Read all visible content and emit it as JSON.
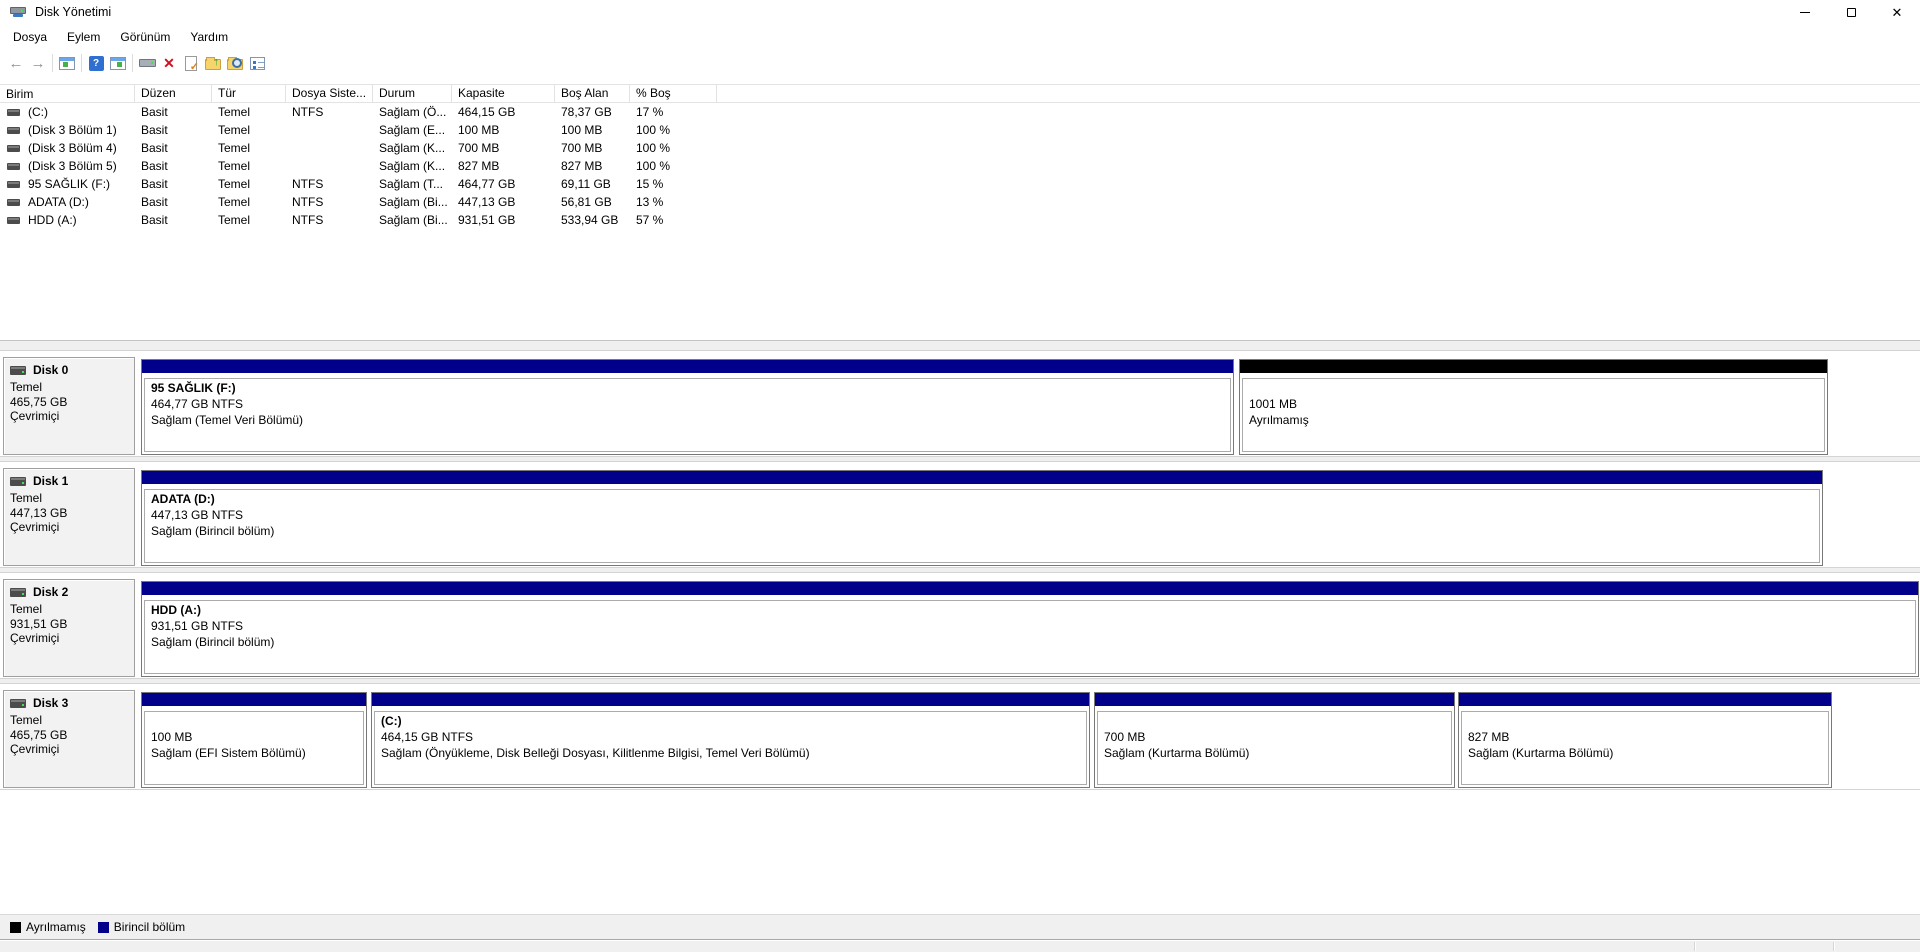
{
  "window": {
    "title": "Disk Yönetimi",
    "controls": [
      "minimize",
      "maximize",
      "close"
    ]
  },
  "menu": {
    "items": [
      "Dosya",
      "Eylem",
      "Görünüm",
      "Yardım"
    ]
  },
  "toolbar": {
    "icons": [
      "back",
      "forward",
      "show-console-tree",
      "help",
      "show-action-pane",
      "drive",
      "delete-volume",
      "check-document",
      "folder-add",
      "folder-search",
      "properties"
    ]
  },
  "volume_list": {
    "columns": [
      "Birim",
      "Düzen",
      "Tür",
      "Dosya Siste...",
      "Durum",
      "Kapasite",
      "Boş Alan",
      "% Boş"
    ],
    "rows": [
      {
        "name": "(C:)",
        "layout": "Basit",
        "type": "Temel",
        "fs": "NTFS",
        "status": "Sağlam (Ö...",
        "capacity": "464,15 GB",
        "free": "78,37 GB",
        "pct": "17 %"
      },
      {
        "name": "(Disk 3 Bölüm 1)",
        "layout": "Basit",
        "type": "Temel",
        "fs": "",
        "status": "Sağlam (E...",
        "capacity": "100 MB",
        "free": "100 MB",
        "pct": "100 %"
      },
      {
        "name": "(Disk 3 Bölüm 4)",
        "layout": "Basit",
        "type": "Temel",
        "fs": "",
        "status": "Sağlam (K...",
        "capacity": "700 MB",
        "free": "700 MB",
        "pct": "100 %"
      },
      {
        "name": "(Disk 3 Bölüm 5)",
        "layout": "Basit",
        "type": "Temel",
        "fs": "",
        "status": "Sağlam (K...",
        "capacity": "827 MB",
        "free": "827 MB",
        "pct": "100 %"
      },
      {
        "name": "95 SAĞLIK (F:)",
        "layout": "Basit",
        "type": "Temel",
        "fs": "NTFS",
        "status": "Sağlam (T...",
        "capacity": "464,77 GB",
        "free": "69,11 GB",
        "pct": "15 %"
      },
      {
        "name": "ADATA (D:)",
        "layout": "Basit",
        "type": "Temel",
        "fs": "NTFS",
        "status": "Sağlam (Bi...",
        "capacity": "447,13 GB",
        "free": "56,81 GB",
        "pct": "13 %"
      },
      {
        "name": "HDD (A:)",
        "layout": "Basit",
        "type": "Temel",
        "fs": "NTFS",
        "status": "Sağlam (Bi...",
        "capacity": "931,51 GB",
        "free": "533,94 GB",
        "pct": "57 %"
      }
    ]
  },
  "disks": [
    {
      "label": "Disk 0",
      "type": "Temel",
      "size": "465,75 GB",
      "status": "Çevrimiçi",
      "partitions": [
        {
          "title": "95 SAĞLIK  (F:)",
          "line2": "464,77 GB NTFS",
          "line3": "Sağlam (Temel Veri Bölümü)",
          "kind": "primary"
        },
        {
          "title": "",
          "line2": "1001 MB",
          "line3": "Ayrılmamış",
          "kind": "unallocated"
        }
      ]
    },
    {
      "label": "Disk 1",
      "type": "Temel",
      "size": "447,13 GB",
      "status": "Çevrimiçi",
      "partitions": [
        {
          "title": "ADATA  (D:)",
          "line2": "447,13 GB NTFS",
          "line3": "Sağlam (Birincil bölüm)",
          "kind": "primary"
        }
      ]
    },
    {
      "label": "Disk 2",
      "type": "Temel",
      "size": "931,51 GB",
      "status": "Çevrimiçi",
      "partitions": [
        {
          "title": "HDD  (A:)",
          "line2": "931,51 GB NTFS",
          "line3": "Sağlam (Birincil bölüm)",
          "kind": "primary"
        }
      ]
    },
    {
      "label": "Disk 3",
      "type": "Temel",
      "size": "465,75 GB",
      "status": "Çevrimiçi",
      "partitions": [
        {
          "title": "",
          "line2": "100 MB",
          "line3": "Sağlam (EFI Sistem Bölümü)",
          "kind": "primary"
        },
        {
          "title": "(C:)",
          "line2": "464,15 GB NTFS",
          "line3": "Sağlam (Önyükleme, Disk Belleği Dosyası, Kilitlenme Bilgisi, Temel Veri Bölümü)",
          "kind": "primary"
        },
        {
          "title": "",
          "line2": "700 MB",
          "line3": "Sağlam (Kurtarma Bölümü)",
          "kind": "primary"
        },
        {
          "title": "",
          "line2": "827 MB",
          "line3": "Sağlam (Kurtarma Bölümü)",
          "kind": "primary"
        }
      ]
    }
  ],
  "legend": {
    "items": [
      {
        "label": "Ayrılmamış",
        "color": "#000000"
      },
      {
        "label": "Birincil bölüm",
        "color": "#00008b"
      }
    ]
  },
  "colors": {
    "primary_partition": "#00008b",
    "unallocated": "#000000"
  }
}
